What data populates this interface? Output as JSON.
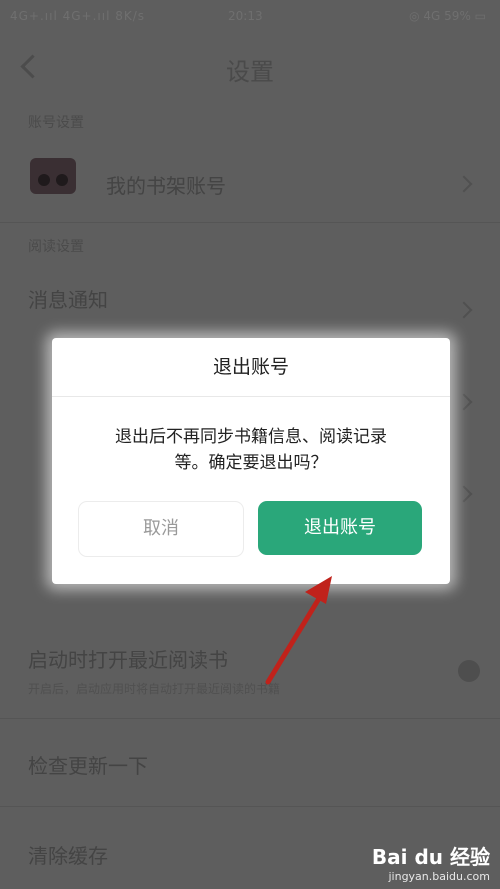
{
  "status_bar": {
    "left": "4G+.ııl 4G+.ııl 8K/s",
    "time": "20:13",
    "right": "◎ 4G 59% ▭"
  },
  "header": {
    "title": "设置"
  },
  "sections": [
    {
      "label": "账号设置"
    },
    {
      "label": "阅读设置"
    }
  ],
  "rows": [
    {
      "text": "我的书架账号"
    },
    {
      "text": "消息通知"
    },
    {
      "text": "启动时打开最近阅读书",
      "sub": "开启后，启动应用时将自动打开最近阅读的书籍"
    },
    {
      "text": "检查更新一下"
    },
    {
      "text": "清除缓存"
    }
  ],
  "dialog": {
    "title": "退出账号",
    "message_line1": "退出后不再同步书籍信息、阅读记录",
    "message_line2": "等。确定要退出吗？",
    "cancel_label": "取消",
    "confirm_label": "退出账号"
  },
  "colors": {
    "primary": "#2aa77a",
    "annotation": "#c0221b"
  },
  "watermark": {
    "brand": "Bai du 经验",
    "url": "jingyan.baidu.com"
  }
}
